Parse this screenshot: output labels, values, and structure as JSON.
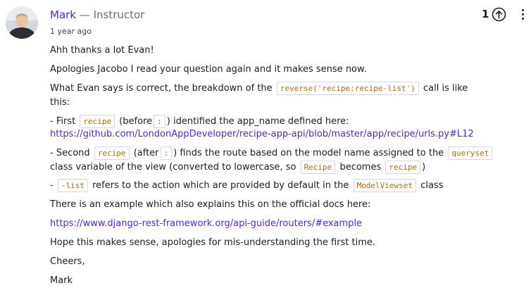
{
  "author": {
    "name": "Mark",
    "separator": "—",
    "role": "Instructor",
    "avatar_icon": "user-avatar-photo"
  },
  "timestamp": "1 year ago",
  "upvote": {
    "count": "1",
    "icon": "arrow-up-circle-icon"
  },
  "menu": {
    "icon": "vertical-ellipsis-icon"
  },
  "colors": {
    "accent": "#5624d0",
    "code_text": "#b4690e",
    "muted": "#6a6f73",
    "text": "#1c1d1f"
  },
  "body": {
    "p1": "Ahh thanks a lot Evan!",
    "p2": "Apologies Jacobo I read your question again and it makes sense now.",
    "p3": {
      "t1": "What Evan says is correct, the breakdown of the",
      "code1": "reverse('recipe:recipe-list')",
      "t2": "call is like this:"
    },
    "p4": {
      "t1": "- First",
      "code1": "recipe",
      "t2": "(before",
      "code2": ":",
      "t3": ") identified the app_name defined here:",
      "link": "https://github.com/LondonAppDeveloper/recipe-app-api/blob/master/app/recipe/urls.py#L12"
    },
    "p5": {
      "t1": "- Second",
      "code1": "recipe",
      "t2": "(after",
      "code2": ":",
      "t3": ") finds the route based on the model name assigned to the",
      "code3": "queryset",
      "t4": "class variable of the view (converted to lowercase, so",
      "code4": "Recipe",
      "t5": "becomes",
      "code5": "recipe",
      "t6": ")"
    },
    "p6": {
      "t1": "-",
      "code1": "-list",
      "t2": "refers to the action which are provided by default in the",
      "code2": "ModelViewset",
      "t3": "class"
    },
    "p7": "There is an example which also explains this on the official docs here:",
    "p8_link": "https://www.django-rest-framework.org/api-guide/routers/#example",
    "p9": "Hope this makes sense, apologies for mis-understanding the first time.",
    "p10": "Cheers,",
    "p11": "Mark"
  }
}
